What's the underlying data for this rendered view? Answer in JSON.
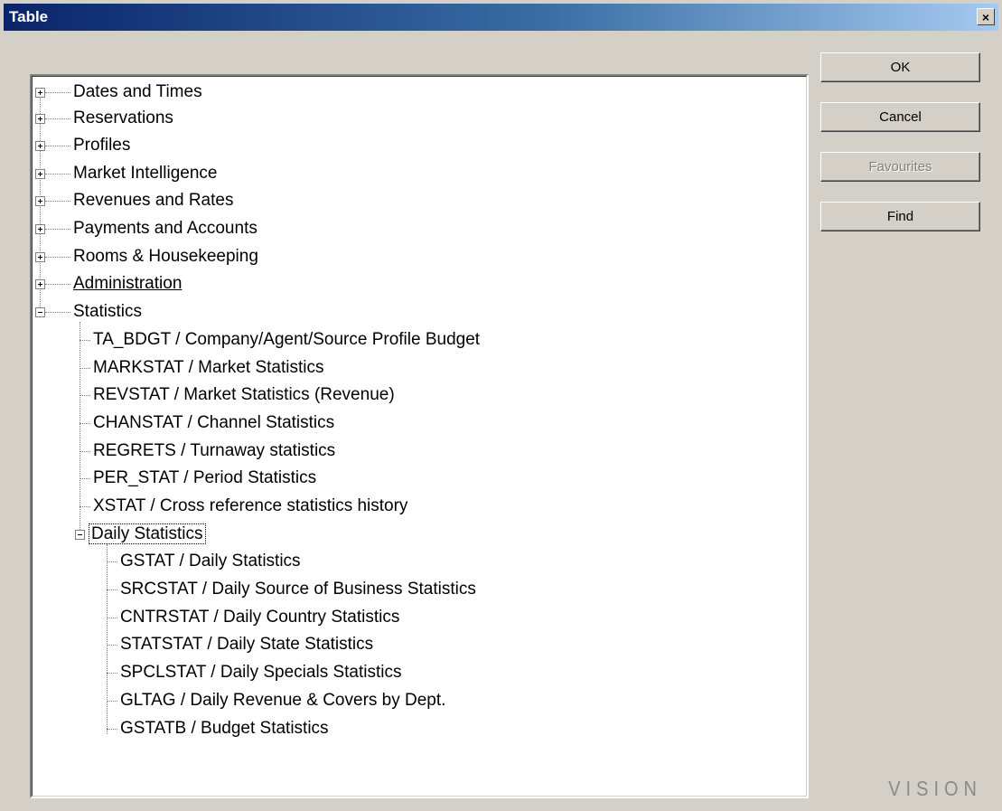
{
  "window": {
    "title": "Table",
    "close_glyph": "×"
  },
  "buttons": {
    "ok": "OK",
    "cancel": "Cancel",
    "favourites": "Favourites",
    "find": "Find"
  },
  "tree": {
    "top_nodes": [
      {
        "label": "Dates and Times",
        "expanded": false
      },
      {
        "label": "Reservations",
        "expanded": false
      },
      {
        "label": "Profiles",
        "expanded": false
      },
      {
        "label": "Market Intelligence",
        "expanded": false
      },
      {
        "label": "Revenues and Rates",
        "expanded": false
      },
      {
        "label": "Payments and Accounts",
        "expanded": false
      },
      {
        "label": "Rooms & Housekeeping",
        "expanded": false
      },
      {
        "label": "Administration",
        "expanded": false
      },
      {
        "label": "Statistics",
        "expanded": true
      }
    ],
    "statistics_children": [
      "TA_BDGT  /  Company/Agent/Source Profile Budget",
      "MARKSTAT  /  Market Statistics",
      "REVSTAT  /  Market Statistics (Revenue)",
      "CHANSTAT  /  Channel Statistics",
      "REGRETS  /  Turnaway statistics",
      "PER_STAT  /  Period Statistics",
      "XSTAT  /  Cross reference statistics history"
    ],
    "daily_statistics": {
      "label": "Daily Statistics",
      "expanded": true,
      "children": [
        "GSTAT  /  Daily Statistics",
        "SRCSTAT  /  Daily Source of Business Statistics",
        "CNTRSTAT  /  Daily Country Statistics",
        "STATSTAT  /  Daily State Statistics",
        "SPCLSTAT  /  Daily Specials Statistics",
        "GLTAG  /  Daily Revenue & Covers by Dept.",
        "GSTATB  /  Budget Statistics"
      ]
    }
  },
  "branding": "VISION",
  "colors": {
    "titlebar_start": "#0a246a",
    "titlebar_end": "#a6caf0",
    "face": "#d4d0c8",
    "disabled_text": "#808080"
  }
}
